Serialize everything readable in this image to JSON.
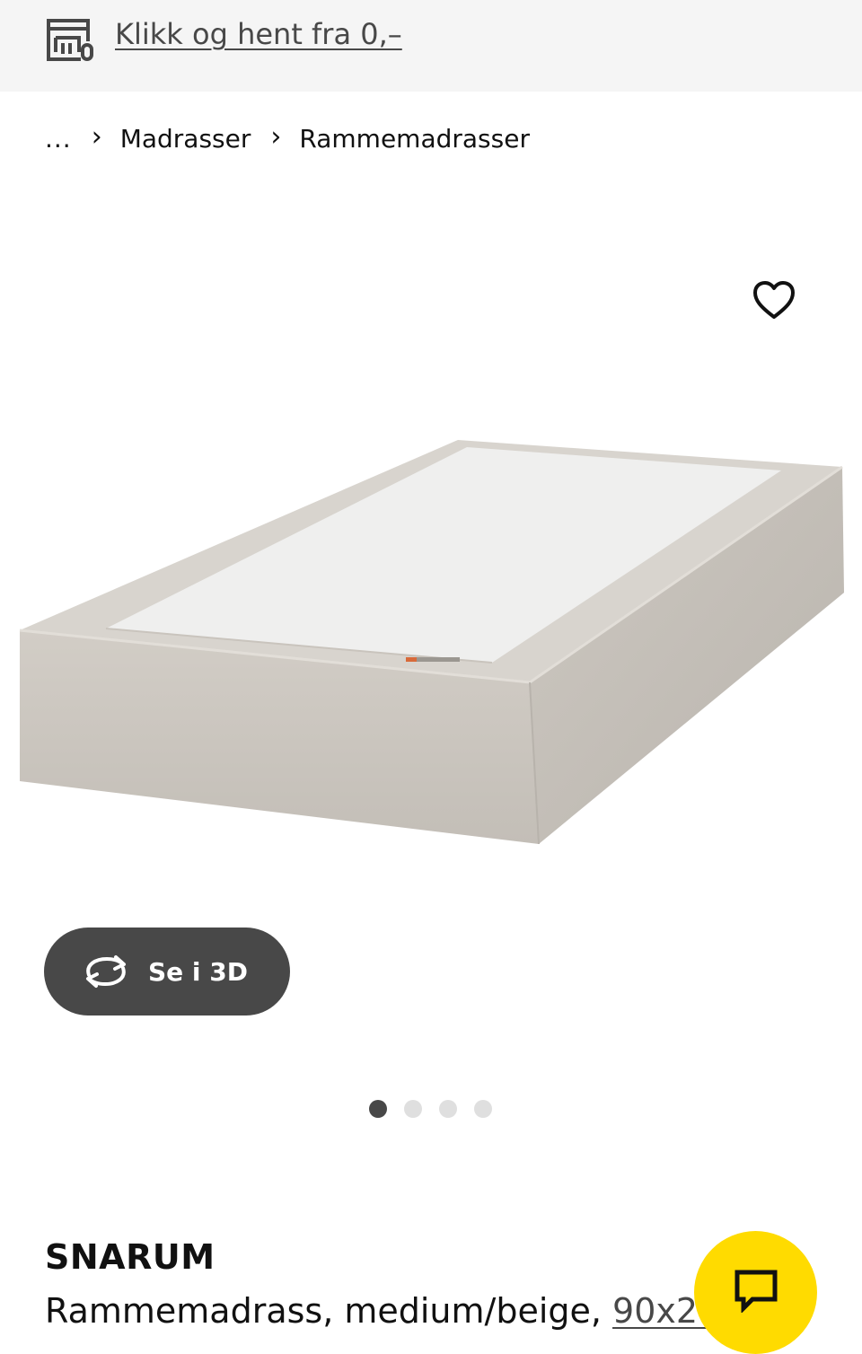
{
  "banner": {
    "icon": "store-icon",
    "link_text": "Klikk og hent fra 0,–"
  },
  "breadcrumb": {
    "ellipsis": "...",
    "items": [
      "Madrasser",
      "Rammemadrasser"
    ],
    "separator_icon": "chevron-right-icon"
  },
  "favourite": {
    "icon": "heart-icon"
  },
  "gallery": {
    "image": "product-image-box-mattress",
    "view_3d_label": "Se i 3D",
    "view_3d_icon": "rotate-3d-icon",
    "total_images": 4,
    "active_index": 0
  },
  "product": {
    "name": "SNARUM",
    "description": "Rammemadrass, medium/beige, ",
    "size_link": "90x200 cm"
  },
  "chat": {
    "icon": "chat-bubble-icon",
    "color": "#ffdb00"
  },
  "colors": {
    "dark_grey": "#484848",
    "banner_bg": "#f5f5f5",
    "dot_inactive": "#dfdfdf"
  }
}
